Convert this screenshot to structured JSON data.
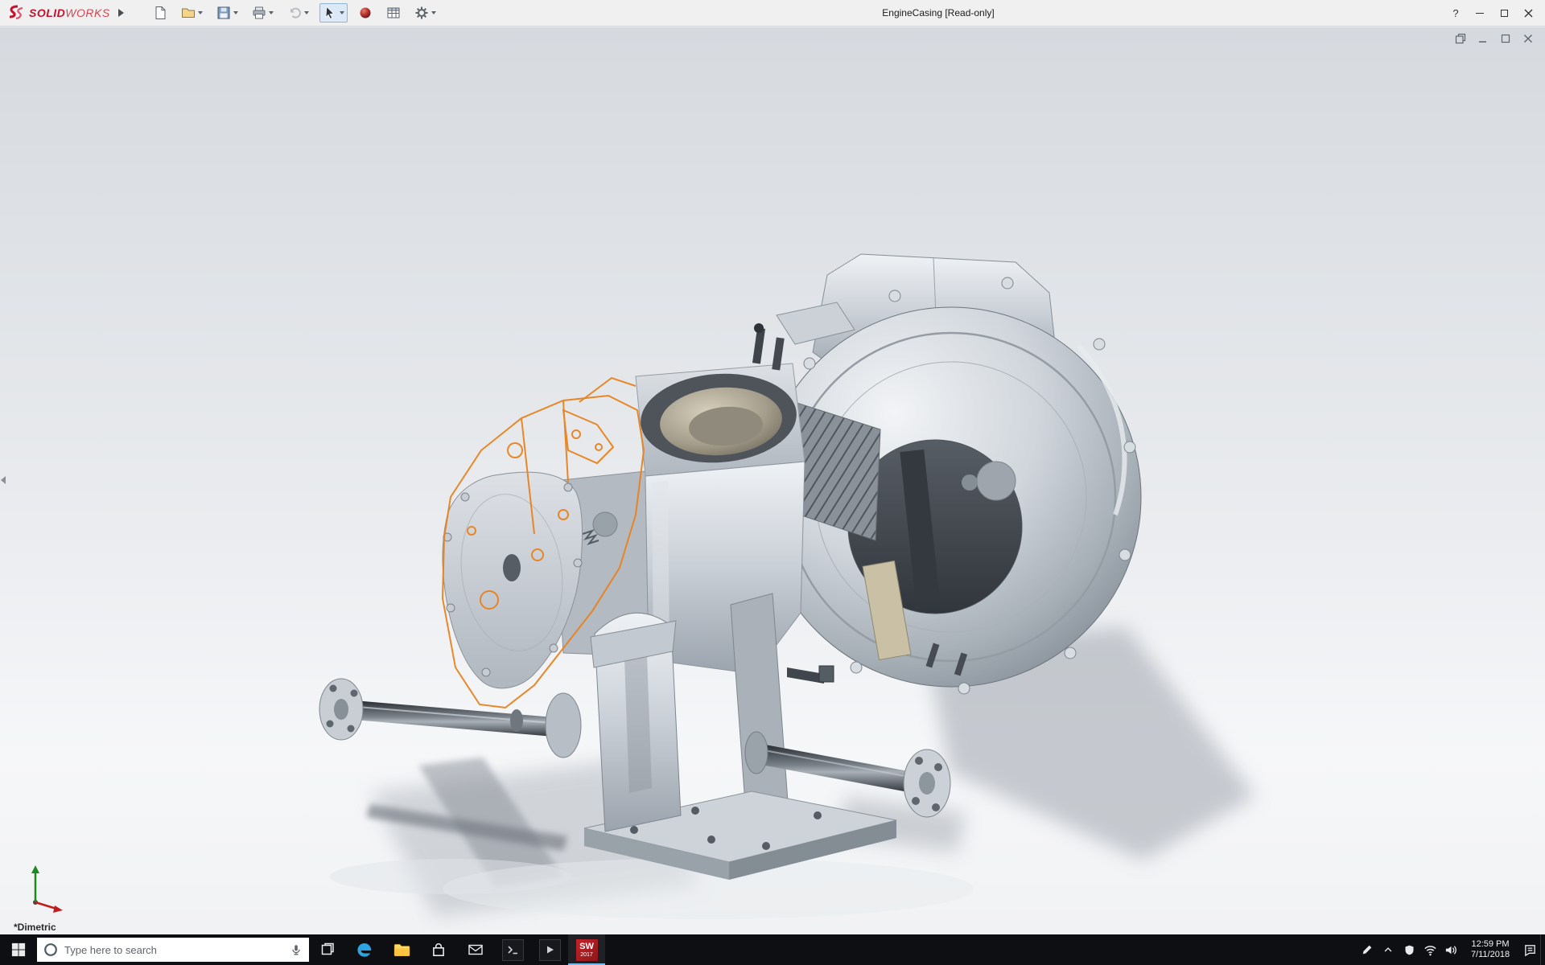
{
  "title_bar": {
    "logo": {
      "brand_solid": "SOLID",
      "brand_works": "WORKS"
    },
    "document_title": "EngineCasing [Read-only]",
    "help_label": "?",
    "toolbar_icons": [
      "flyout-arrow",
      "new-document",
      "open",
      "save",
      "print",
      "undo",
      "select-tool",
      "appearance-sphere",
      "design-table",
      "options-gear"
    ]
  },
  "document_window": {
    "controls": [
      "cascade",
      "minimize",
      "restore",
      "close"
    ]
  },
  "viewport": {
    "orientation_label": "*Dimetric",
    "sketch_color": "#e8821e"
  },
  "taskbar": {
    "search_placeholder": "Type here to search",
    "app_icons": [
      "start",
      "task-view",
      "edge",
      "file-explorer",
      "store",
      "mail",
      "command-prompt",
      "film-tv",
      "solidworks-2017"
    ],
    "solidworks_badge_top": "SW",
    "solidworks_badge_year": "2017",
    "tray_icons": [
      "pen",
      "chevron-up",
      "defender-shield",
      "network",
      "volume",
      "action-center"
    ],
    "clock_time": "12:59 PM",
    "clock_date": "7/11/2018"
  }
}
